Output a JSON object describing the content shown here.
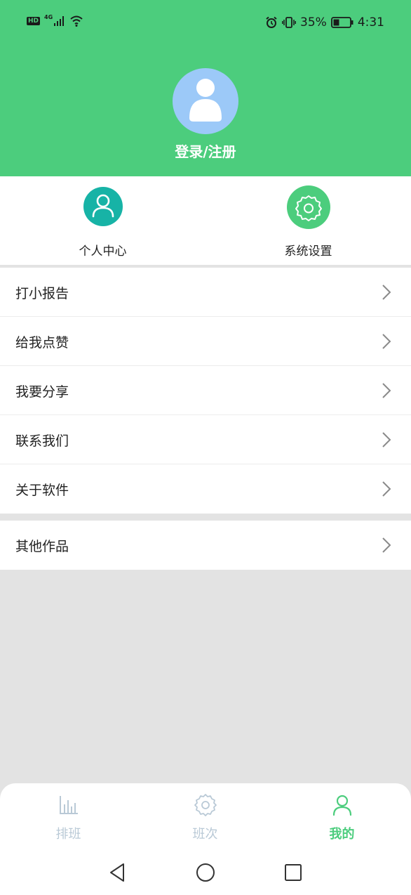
{
  "status_bar": {
    "hd": "HD",
    "network": "4G",
    "battery_pct": "35%",
    "time": "4:31"
  },
  "header": {
    "login_label": "登录/注册",
    "bg_color": "#4ccd7d"
  },
  "quick_actions": [
    {
      "label": "个人中心",
      "icon": "person-icon",
      "color": "#17b3a6"
    },
    {
      "label": "系统设置",
      "icon": "gear-icon",
      "color": "#4ccd7d"
    }
  ],
  "menu_group1": [
    {
      "label": "打小报告"
    },
    {
      "label": "给我点赞"
    },
    {
      "label": "我要分享"
    },
    {
      "label": "联系我们"
    },
    {
      "label": "关于软件"
    }
  ],
  "menu_group2": [
    {
      "label": "其他作品"
    }
  ],
  "tabs": [
    {
      "label": "排班",
      "icon": "bar-chart-icon",
      "active": false
    },
    {
      "label": "班次",
      "icon": "gear-icon",
      "active": false
    },
    {
      "label": "我的",
      "icon": "person-icon",
      "active": true
    }
  ],
  "colors": {
    "accent": "#4ccd7d",
    "tab_inactive": "#b9c9d6",
    "tab_active": "#4ccd7d"
  }
}
